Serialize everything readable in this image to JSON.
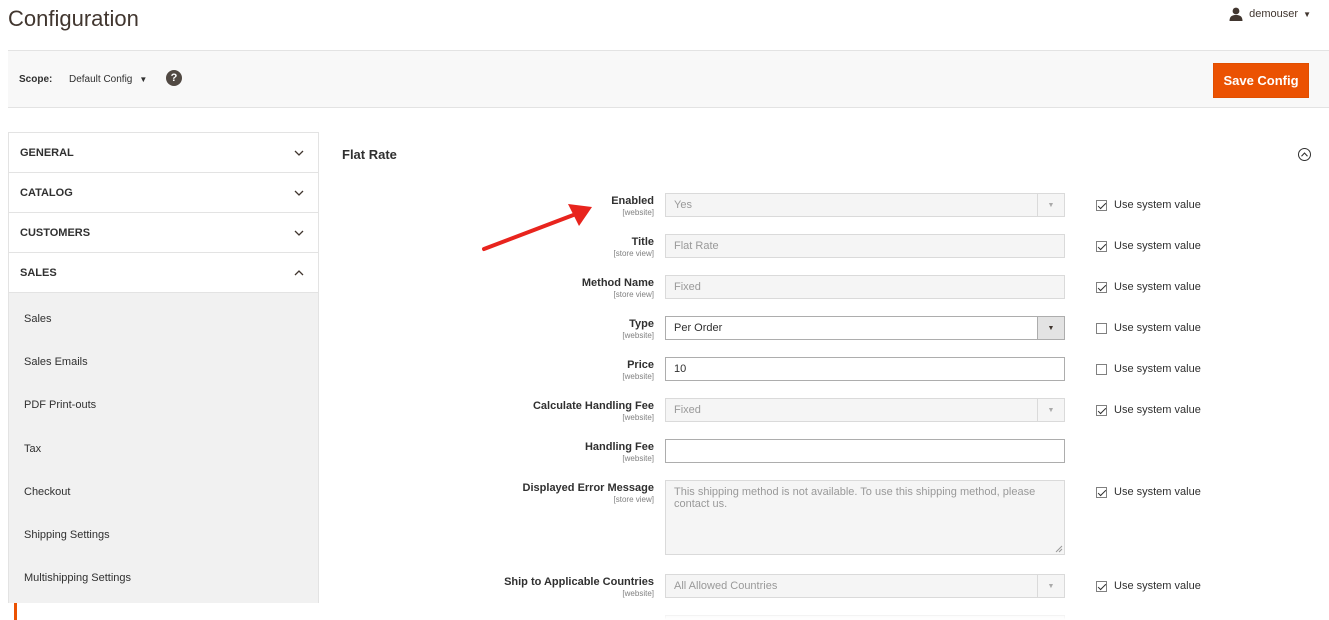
{
  "header": {
    "title": "Configuration",
    "user": "demouser"
  },
  "scope": {
    "label": "Scope:",
    "value": "Default Config",
    "help": "?",
    "save_label": "Save Config"
  },
  "sidebar": {
    "sections": [
      {
        "label": "GENERAL",
        "expanded": false
      },
      {
        "label": "CATALOG",
        "expanded": false
      },
      {
        "label": "CUSTOMERS",
        "expanded": false
      },
      {
        "label": "SALES",
        "expanded": true
      }
    ],
    "sales_items": [
      "Sales",
      "Sales Emails",
      "PDF Print-outs",
      "Tax",
      "Checkout",
      "Shipping Settings",
      "Multishipping Settings"
    ]
  },
  "section": {
    "title": "Flat Rate"
  },
  "system_value_label": "Use system value",
  "fields": [
    {
      "label": "Enabled",
      "scope": "[website]",
      "value": "Yes",
      "type": "select",
      "disabled": true,
      "use_system": true
    },
    {
      "label": "Title",
      "scope": "[store view]",
      "value": "Flat Rate",
      "type": "input",
      "disabled": true,
      "use_system": true
    },
    {
      "label": "Method Name",
      "scope": "[store view]",
      "value": "Fixed",
      "type": "input",
      "disabled": true,
      "use_system": true
    },
    {
      "label": "Type",
      "scope": "[website]",
      "value": "Per Order",
      "type": "select",
      "disabled": false,
      "use_system": false
    },
    {
      "label": "Price",
      "scope": "[website]",
      "value": "10",
      "type": "input",
      "disabled": false,
      "use_system": false
    },
    {
      "label": "Calculate Handling Fee",
      "scope": "[website]",
      "value": "Fixed",
      "type": "select",
      "disabled": true,
      "use_system": true
    },
    {
      "label": "Handling Fee",
      "scope": "[website]",
      "value": "",
      "type": "input",
      "disabled": false
    },
    {
      "label": "Displayed Error Message",
      "scope": "[store view]",
      "value": "This shipping method is not available. To use this shipping method, please contact us.",
      "type": "textarea",
      "disabled": true,
      "use_system": true
    },
    {
      "label": "Ship to Applicable Countries",
      "scope": "[website]",
      "value": "All Allowed Countries",
      "type": "select",
      "disabled": true,
      "use_system": true
    }
  ],
  "colors": {
    "accent": "#eb5202",
    "annotation_arrow": "#e8241d"
  }
}
